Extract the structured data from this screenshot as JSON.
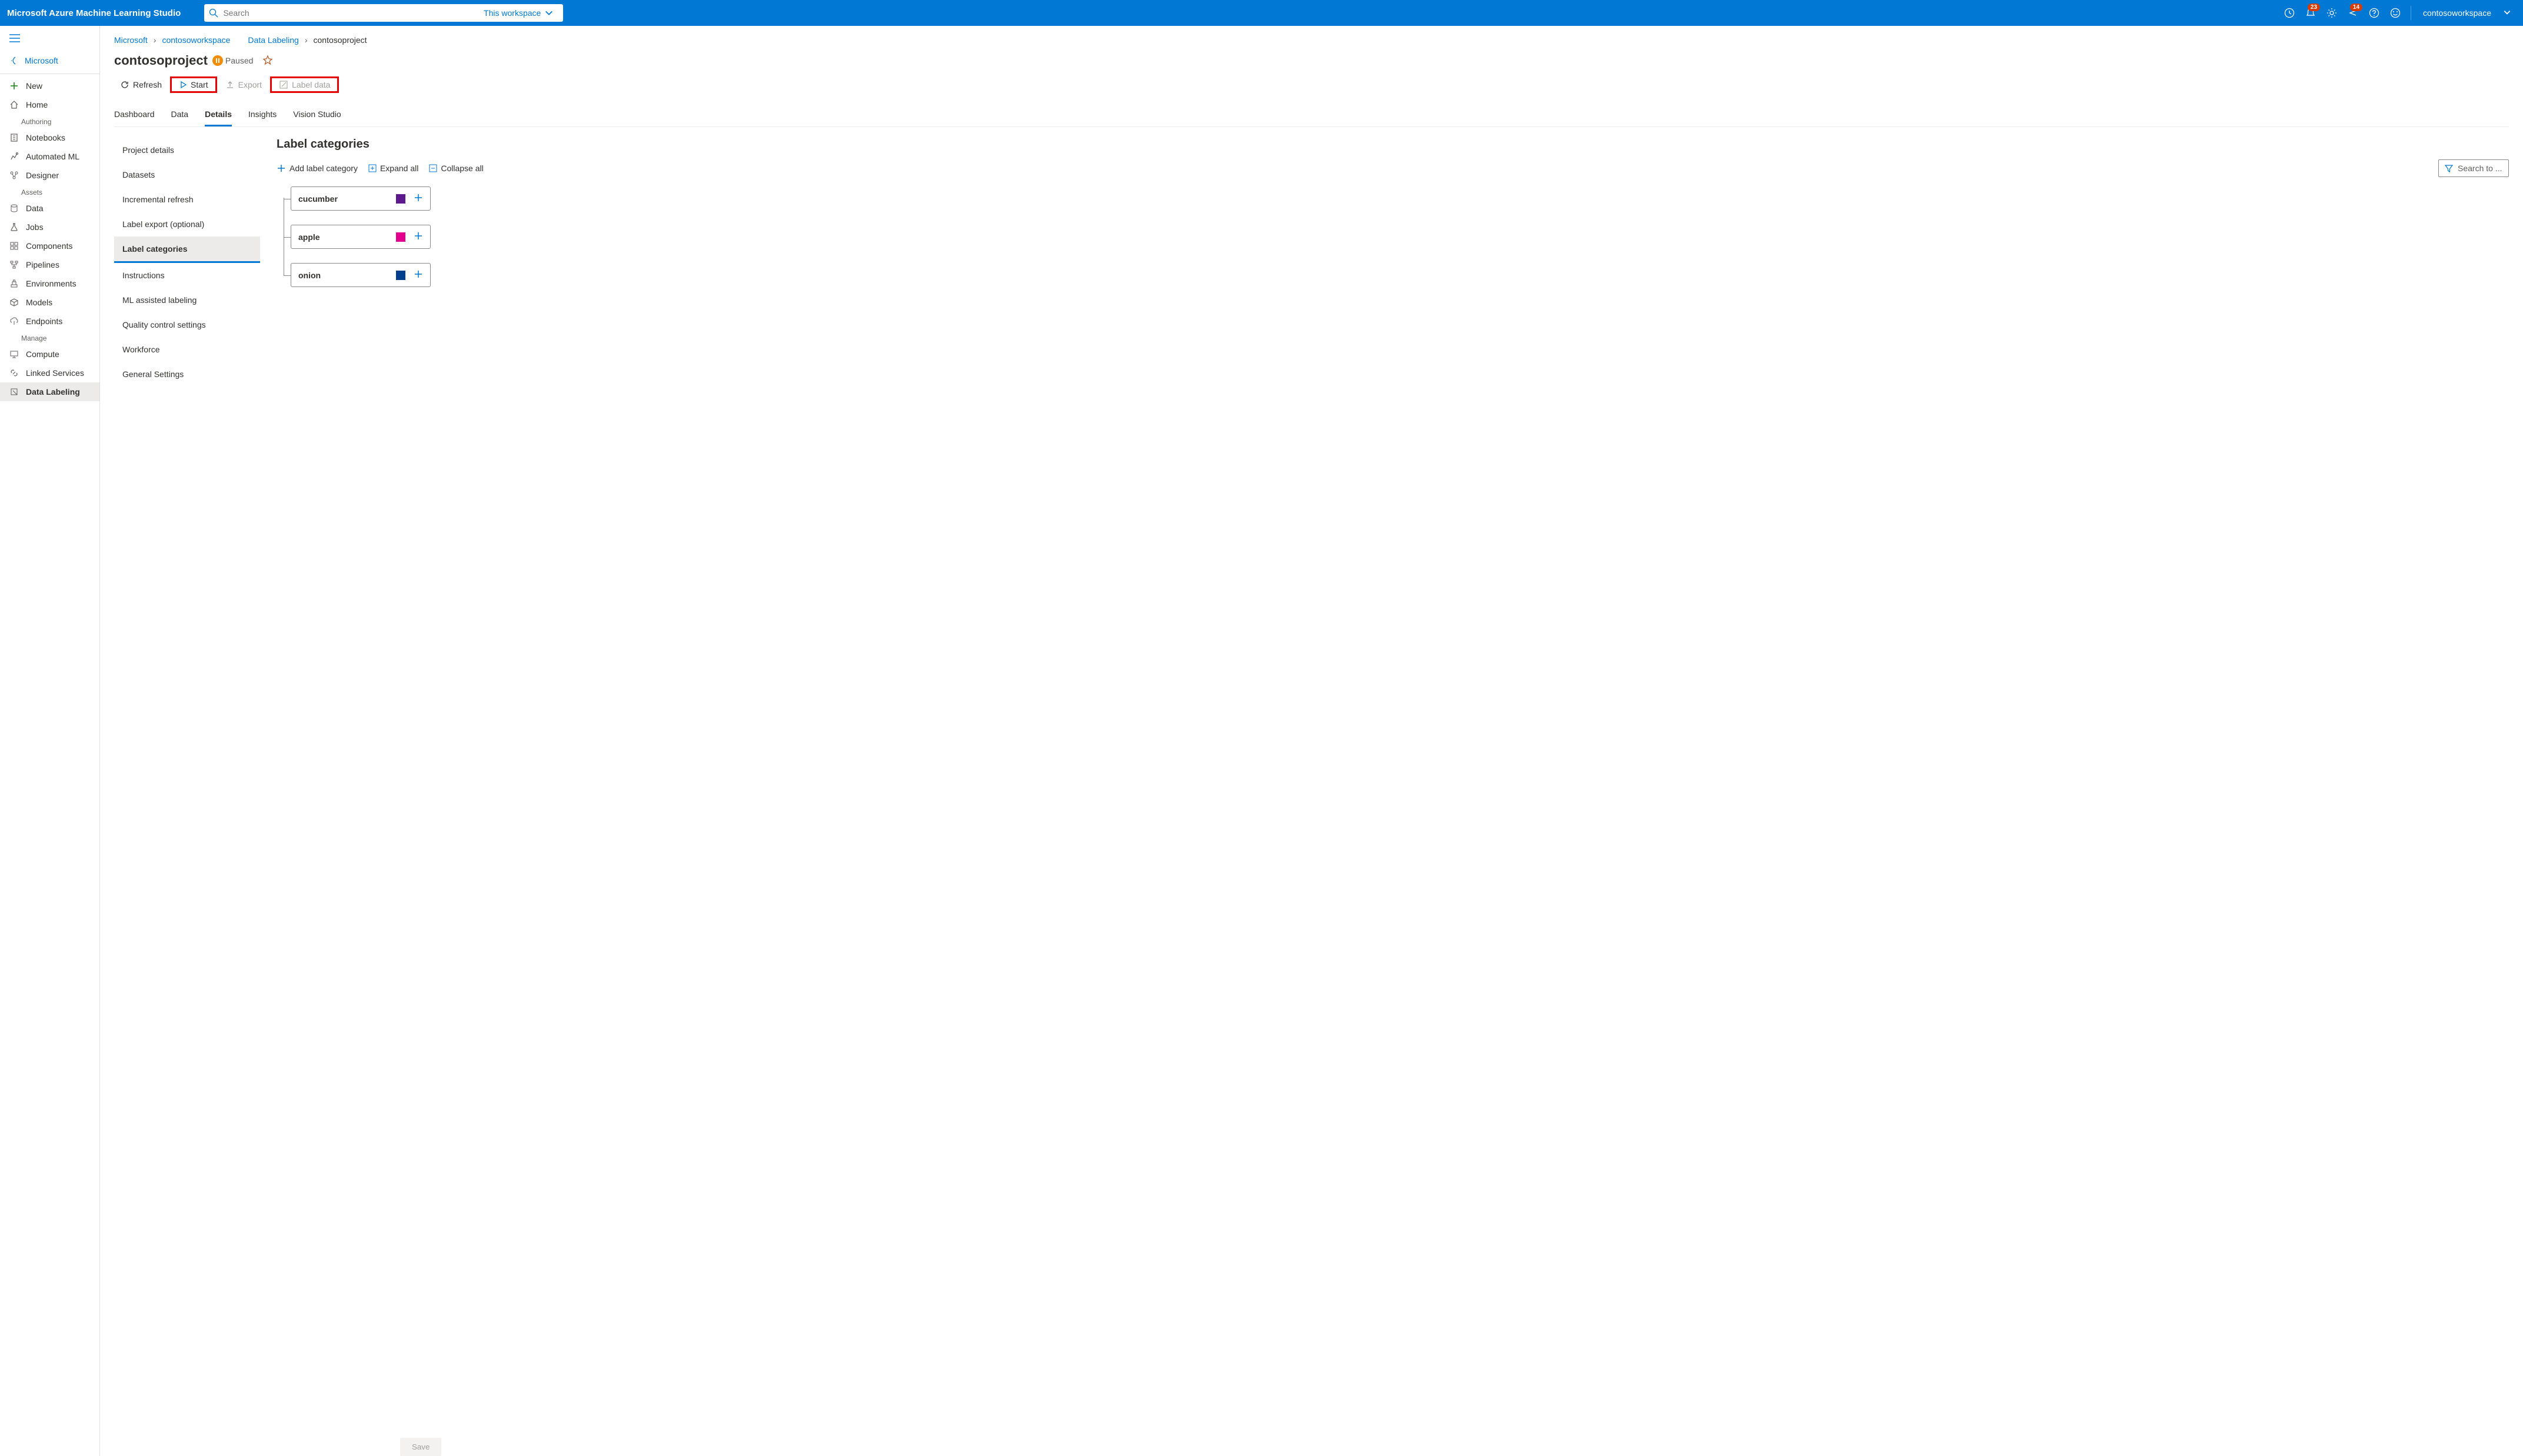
{
  "header": {
    "product": "Microsoft Azure Machine Learning Studio",
    "search_placeholder": "Search",
    "scope": "This workspace",
    "notif_badge": "23",
    "directory_badge": "14",
    "workspace": "contosoworkspace"
  },
  "sidebar": {
    "back_label": "Microsoft",
    "new": "New",
    "home": "Home",
    "section_authoring": "Authoring",
    "notebooks": "Notebooks",
    "automl": "Automated ML",
    "designer": "Designer",
    "section_assets": "Assets",
    "data": "Data",
    "jobs": "Jobs",
    "components": "Components",
    "pipelines": "Pipelines",
    "environments": "Environments",
    "models": "Models",
    "endpoints": "Endpoints",
    "section_manage": "Manage",
    "compute": "Compute",
    "linked": "Linked Services",
    "labeling": "Data Labeling"
  },
  "breadcrumb": {
    "root": "Microsoft",
    "workspace": "contosoworkspace",
    "section": "Data Labeling",
    "project": "contosoproject"
  },
  "title": {
    "name": "contosoproject",
    "status": "Paused"
  },
  "toolbar": {
    "refresh": "Refresh",
    "start": "Start",
    "export": "Export",
    "label_data": "Label data"
  },
  "tabs": {
    "dashboard": "Dashboard",
    "data": "Data",
    "details": "Details",
    "insights": "Insights",
    "vision": "Vision Studio"
  },
  "subnav": {
    "project_details": "Project details",
    "datasets": "Datasets",
    "incremental": "Incremental refresh",
    "label_export": "Label export (optional)",
    "label_categories": "Label categories",
    "instructions": "Instructions",
    "ml_assisted": "ML assisted labeling",
    "quality": "Quality control settings",
    "workforce": "Workforce",
    "general": "General Settings"
  },
  "content": {
    "heading": "Label categories",
    "add_label": "Add label category",
    "expand_all": "Expand all",
    "collapse_all": "Collapse all",
    "filter_placeholder": "Search to ...",
    "save": "Save",
    "categories": [
      {
        "name": "cucumber",
        "color": "#5c1a8e"
      },
      {
        "name": "apple",
        "color": "#e3008c"
      },
      {
        "name": "onion",
        "color": "#003f8c"
      }
    ]
  }
}
